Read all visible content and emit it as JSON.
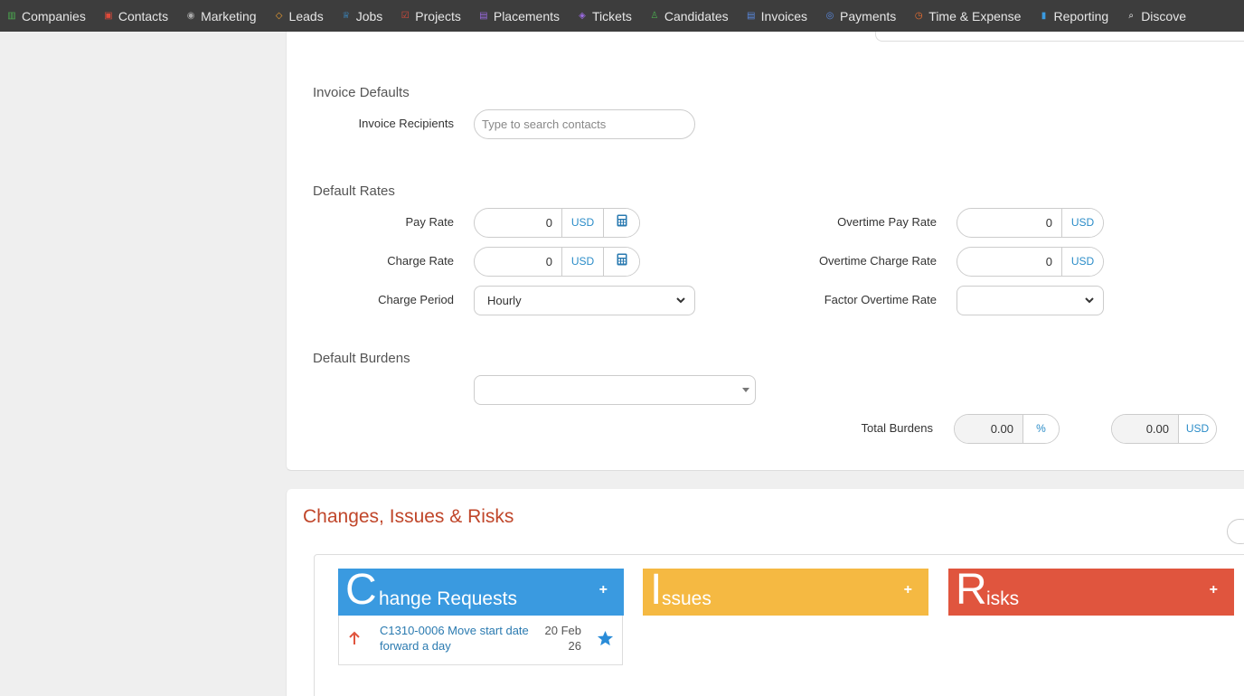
{
  "nav": {
    "items": [
      {
        "label": "Companies",
        "icon": "building-icon",
        "color": "#4caf50"
      },
      {
        "label": "Contacts",
        "icon": "contact-card-icon",
        "color": "#e04a3a"
      },
      {
        "label": "Marketing",
        "icon": "broadcast-icon",
        "color": "#aaaaaa"
      },
      {
        "label": "Leads",
        "icon": "diamond-icon",
        "color": "#f0a030"
      },
      {
        "label": "Jobs",
        "icon": "trophy-icon",
        "color": "#3a9ae0"
      },
      {
        "label": "Projects",
        "icon": "checkbox-icon",
        "color": "#e04a3a"
      },
      {
        "label": "Placements",
        "icon": "briefcase-icon",
        "color": "#9a6ae0"
      },
      {
        "label": "Tickets",
        "icon": "tag-icon",
        "color": "#9a6ae0"
      },
      {
        "label": "Candidates",
        "icon": "person-icon",
        "color": "#4caf50"
      },
      {
        "label": "Invoices",
        "icon": "document-icon",
        "color": "#5a8ae0"
      },
      {
        "label": "Payments",
        "icon": "coins-icon",
        "color": "#5a8ae0"
      },
      {
        "label": "Time & Expense",
        "icon": "clock-icon",
        "color": "#f07030"
      },
      {
        "label": "Reporting",
        "icon": "bar-chart-icon",
        "color": "#3a9ae0"
      },
      {
        "label": "Discove",
        "icon": "search-icon",
        "color": "#ffffff"
      }
    ]
  },
  "invoice_defaults": {
    "title": "Invoice Defaults",
    "recipients_label": "Invoice Recipients",
    "recipients_placeholder": "Type to search contacts"
  },
  "default_rates": {
    "title": "Default Rates",
    "pay_rate_label": "Pay Rate",
    "pay_rate_value": "0",
    "charge_rate_label": "Charge Rate",
    "charge_rate_value": "0",
    "charge_period_label": "Charge Period",
    "charge_period_value": "Hourly",
    "overtime_pay_rate_label": "Overtime Pay Rate",
    "overtime_pay_rate_value": "0",
    "overtime_charge_rate_label": "Overtime Charge Rate",
    "overtime_charge_rate_value": "0",
    "factor_overtime_rate_label": "Factor Overtime Rate",
    "factor_overtime_rate_value": "",
    "currency": "USD"
  },
  "default_burdens": {
    "title": "Default Burdens",
    "total_label": "Total Burdens",
    "total_percent_value": "0.00",
    "percent_unit": "%",
    "total_amount_value": "0.00",
    "amount_unit": "USD"
  },
  "cir": {
    "title": "Changes, Issues & Risks",
    "columns": [
      {
        "initial": "C",
        "rest": "hange Requests",
        "color": "#3a9ae0"
      },
      {
        "initial": "I",
        "rest": "ssues",
        "color": "#f5b942"
      },
      {
        "initial": "R",
        "rest": "isks",
        "color": "#e0553e"
      }
    ],
    "add_label": "+",
    "change_requests": [
      {
        "title": "C1310-0006 Move start date forward a day",
        "date_line1": "20 Feb",
        "date_line2": "26"
      }
    ]
  }
}
